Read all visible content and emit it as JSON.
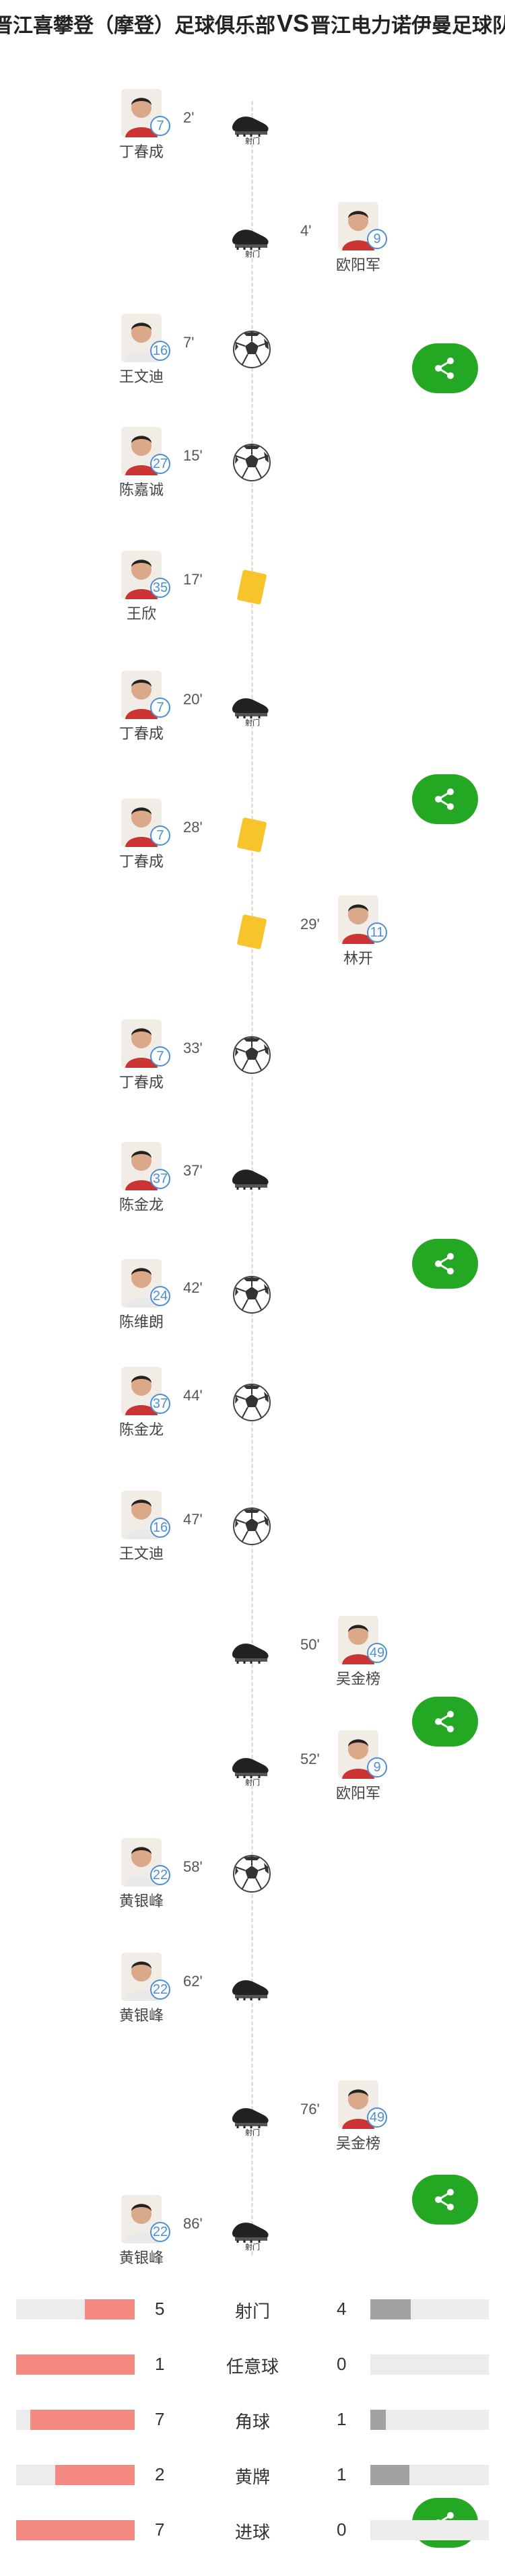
{
  "header": {
    "home_team": "晋江喜攀登（摩登）足球俱乐部",
    "vs": "VS",
    "away_team": "晋江电力诺伊曼足球队"
  },
  "shot_label": "射门",
  "events": [
    {
      "minute": "2'",
      "type": "shot",
      "side": "home",
      "player": "丁春成",
      "number": "7"
    },
    {
      "minute": "4'",
      "type": "shot",
      "side": "away",
      "player": "欧阳军",
      "number": "9"
    },
    {
      "minute": "7'",
      "type": "goal",
      "side": "home",
      "player": "王文迪",
      "number": "16"
    },
    {
      "minute": "15'",
      "type": "goal",
      "side": "home",
      "player": "陈嘉诚",
      "number": "27"
    },
    {
      "minute": "17'",
      "type": "yellow",
      "side": "home",
      "player": "王欣",
      "number": "35"
    },
    {
      "minute": "20'",
      "type": "shot",
      "side": "home",
      "player": "丁春成",
      "number": "7"
    },
    {
      "minute": "28'",
      "type": "yellow",
      "side": "home",
      "player": "丁春成",
      "number": "7"
    },
    {
      "minute": "29'",
      "type": "yellow",
      "side": "away",
      "player": "林开",
      "number": "11"
    },
    {
      "minute": "33'",
      "type": "goal",
      "side": "home",
      "player": "丁春成",
      "number": "7"
    },
    {
      "minute": "37'",
      "type": "freekick",
      "side": "home",
      "player": "陈金龙",
      "number": "37"
    },
    {
      "minute": "42'",
      "type": "goal",
      "side": "home",
      "player": "陈维朗",
      "number": "24"
    },
    {
      "minute": "44'",
      "type": "goal",
      "side": "home",
      "player": "陈金龙",
      "number": "37"
    },
    {
      "minute": "47'",
      "type": "goal",
      "side": "home",
      "player": "王文迪",
      "number": "16"
    },
    {
      "minute": "50'",
      "type": "corner",
      "side": "away",
      "player": "吴金榜",
      "number": "49"
    },
    {
      "minute": "52'",
      "type": "shot",
      "side": "away",
      "player": "欧阳军",
      "number": "9"
    },
    {
      "minute": "58'",
      "type": "goal",
      "side": "home",
      "player": "黄银峰",
      "number": "22"
    },
    {
      "minute": "62'",
      "type": "corner",
      "side": "home",
      "player": "黄银峰",
      "number": "22"
    },
    {
      "minute": "76'",
      "type": "shot",
      "side": "away",
      "player": "吴金榜",
      "number": "49"
    },
    {
      "minute": "86'",
      "type": "shot",
      "side": "home",
      "player": "黄银峰",
      "number": "22"
    }
  ],
  "share_buttons": [
    "share-1",
    "share-2",
    "share-3",
    "share-4",
    "share-5",
    "share-6"
  ],
  "stats": [
    {
      "label": "射门",
      "home": "5",
      "away": "4",
      "home_frac": 0.42,
      "away_frac": 0.34
    },
    {
      "label": "任意球",
      "home": "1",
      "away": "0",
      "home_frac": 1.0,
      "away_frac": 0.0
    },
    {
      "label": "角球",
      "home": "7",
      "away": "1",
      "home_frac": 0.88,
      "away_frac": 0.13
    },
    {
      "label": "黄牌",
      "home": "2",
      "away": "1",
      "home_frac": 0.67,
      "away_frac": 0.33
    },
    {
      "label": "进球",
      "home": "7",
      "away": "0",
      "home_frac": 1.0,
      "away_frac": 0.0
    }
  ],
  "colors": {
    "home_bar": "#f58a82",
    "away_bar": "#a2a2a2",
    "share": "#24a824",
    "number_ring": "#4d8fd6",
    "yellow_card": "#f7c42b"
  }
}
